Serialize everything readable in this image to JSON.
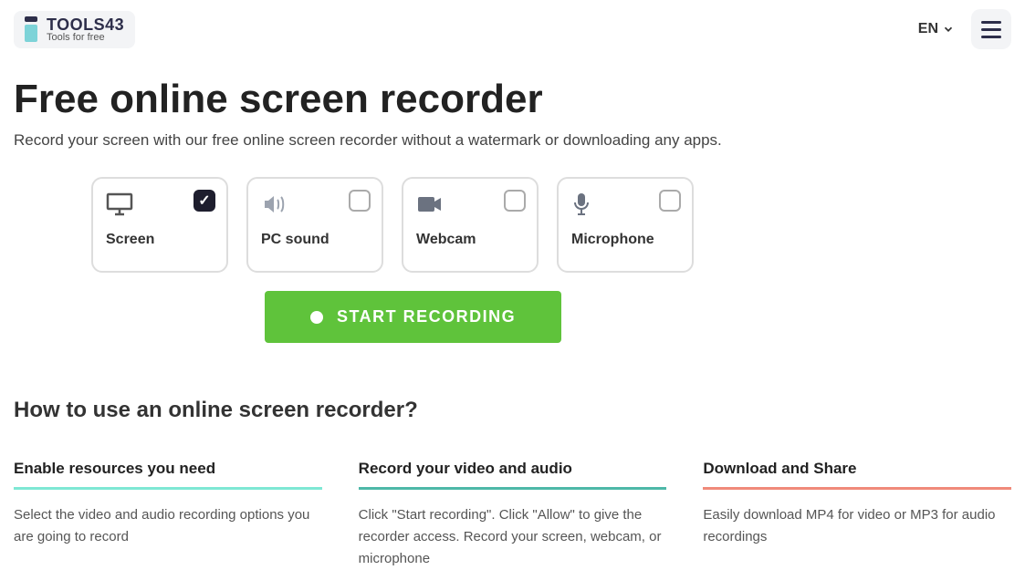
{
  "header": {
    "logo_title": "TOOLS43",
    "logo_sub": "Tools for free",
    "lang": "EN"
  },
  "page": {
    "title": "Free online screen recorder",
    "subtitle": "Record your screen with our free online screen recorder without a watermark or downloading any apps."
  },
  "options": [
    {
      "label": "Screen",
      "checked": true
    },
    {
      "label": "PC sound",
      "checked": false
    },
    {
      "label": "Webcam",
      "checked": false
    },
    {
      "label": "Microphone",
      "checked": false
    }
  ],
  "start_button": "START RECORDING",
  "howto_title": "How to use an online screen recorder?",
  "steps": [
    {
      "title": "Enable resources you need",
      "desc": "Select the video and audio recording options you are going to record"
    },
    {
      "title": "Record your video and audio",
      "desc": "Click \"Start recording\". Click \"Allow\" to give the recorder access. Record your screen, webcam, or microphone"
    },
    {
      "title": "Download and Share",
      "desc": "Easily download MP4 for video or MP3 for audio recordings"
    }
  ]
}
